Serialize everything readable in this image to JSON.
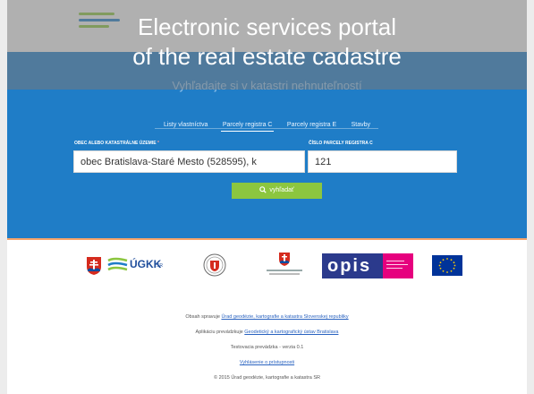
{
  "caption": {
    "line1": "Electronic services portal",
    "line2": "of the real estate cadastre"
  },
  "search": {
    "title": "Vyhľadajte si v katastri nehnuteľností",
    "tabs": [
      {
        "label": "Listy vlastníctva",
        "active": false
      },
      {
        "label": "Parcely registra C",
        "active": true
      },
      {
        "label": "Parcely registra E",
        "active": false
      },
      {
        "label": "Stavby",
        "active": false
      }
    ],
    "municipality_label": "OBEC ALEBO KATASTRÁLNE ÚZEMIE",
    "municipality_required": "*",
    "municipality_value": "obec Bratislava-Staré Mesto (528595), k",
    "parcel_label": "ČÍSLO PARCELY REGISTRA C",
    "parcel_value": "121",
    "button_label": "vyhľadať"
  },
  "partners": {
    "ugkk_text": "ÚGKK",
    "ugkk_suffix": "SR",
    "opis_text": "opis"
  },
  "footer": {
    "content_prefix": "Obsah spravuje",
    "content_link": "Úrad geodézie, kartografie a katastra Slovenskej republiky",
    "operator_prefix": "Aplikáciu prevádzkuje",
    "operator_link": "Geodetický a kartografický ústav Bratislava",
    "test_text": "Testovacia prevádzka - verzia 0.1",
    "accessibility_link": "Vyhlásenie o prístupnosti",
    "copyright": "© 2015 Úrad geodézie, kartografie a katastra SR"
  },
  "colors": {
    "primary_blue": "#1f7dc7",
    "search_green": "#8cc63f",
    "accent_orange": "#f5a46b",
    "opis_blue": "#2b3a8c",
    "opis_pink": "#e6007e"
  }
}
